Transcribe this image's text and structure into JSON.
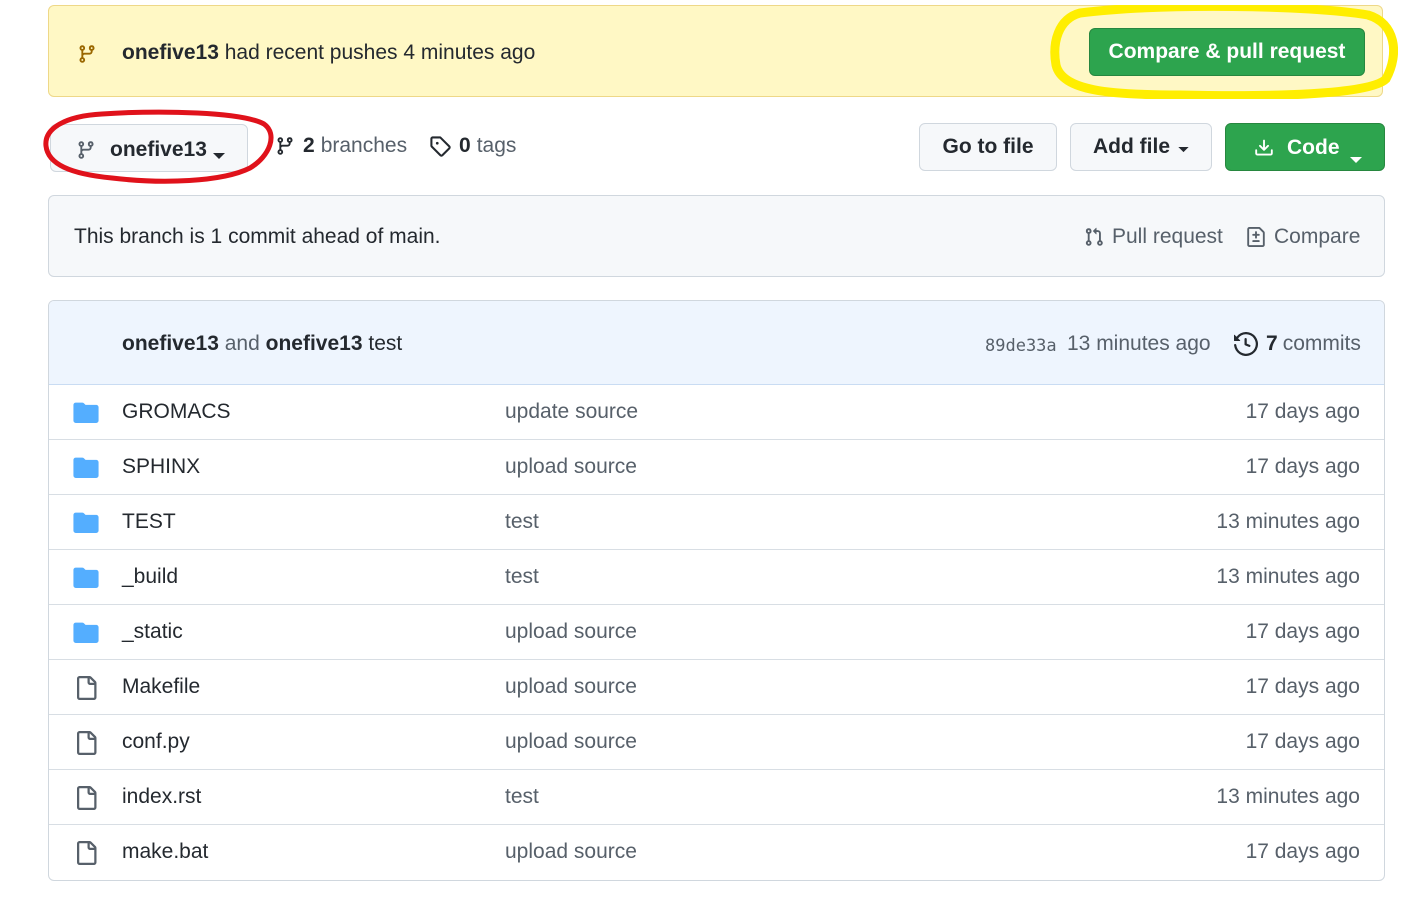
{
  "banner": {
    "branch": "onefive13",
    "message": "had recent pushes 4 minutes ago",
    "compare_button": "Compare & pull request"
  },
  "branch_bar": {
    "current_branch": "onefive13",
    "branches_count": "2",
    "branches_label": "branches",
    "tags_count": "0",
    "tags_label": "tags",
    "go_to_file": "Go to file",
    "add_file": "Add file",
    "code": "Code"
  },
  "ahead": {
    "text": "This branch is 1 commit ahead of main.",
    "pull_request": "Pull request",
    "compare": "Compare"
  },
  "latest_commit": {
    "author1": "onefive13",
    "and": "and",
    "author2": "onefive13",
    "message": "test",
    "sha": "89de33a",
    "time": "13 minutes ago",
    "commits_count": "7",
    "commits_label": "commits"
  },
  "files": [
    {
      "type": "dir",
      "name": "GROMACS",
      "message": "update source",
      "age": "17 days ago"
    },
    {
      "type": "dir",
      "name": "SPHINX",
      "message": "upload source",
      "age": "17 days ago"
    },
    {
      "type": "dir",
      "name": "TEST",
      "message": "test",
      "age": "13 minutes ago"
    },
    {
      "type": "dir",
      "name": "_build",
      "message": "test",
      "age": "13 minutes ago"
    },
    {
      "type": "dir",
      "name": "_static",
      "message": "upload source",
      "age": "17 days ago"
    },
    {
      "type": "file",
      "name": "Makefile",
      "message": "upload source",
      "age": "17 days ago"
    },
    {
      "type": "file",
      "name": "conf.py",
      "message": "upload source",
      "age": "17 days ago"
    },
    {
      "type": "file",
      "name": "index.rst",
      "message": "test",
      "age": "13 minutes ago"
    },
    {
      "type": "file",
      "name": "make.bat",
      "message": "upload source",
      "age": "17 days ago"
    }
  ],
  "colors": {
    "green": "#2da44e",
    "banner_bg": "#fff8c5",
    "folder": "#54aeff",
    "highlight_yellow": "#ffee00",
    "highlight_red": "#e0121b"
  }
}
